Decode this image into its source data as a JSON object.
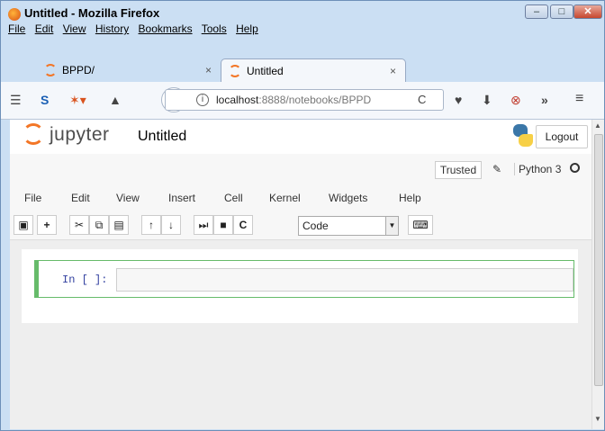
{
  "window": {
    "title": "Untitled - Mozilla Firefox",
    "menu": [
      "File",
      "Edit",
      "View",
      "History",
      "Bookmarks",
      "Tools",
      "Help"
    ],
    "controls": [
      "minimize",
      "maximize",
      "close"
    ]
  },
  "tabs": [
    {
      "label": "BPPD/",
      "close": "×",
      "active": false
    },
    {
      "label": "Untitled",
      "close": "×",
      "active": true
    }
  ],
  "nav": {
    "url_host": "localhost",
    "url_rest": ":8888/notebooks/BPPD",
    "icons": [
      "rss-icon",
      "s-icon",
      "firefox-icon",
      "library-icon",
      "pocket-icon",
      "download-icon",
      "block-icon",
      "overflow-icon",
      "hamburger-menu-icon"
    ]
  },
  "jupyter": {
    "brand": "jupyter",
    "notebook_title": "Untitled",
    "logout": "Logout",
    "trusted": "Trusted",
    "kernel": "Python 3",
    "menu": [
      "File",
      "Edit",
      "View",
      "Insert",
      "Cell",
      "Kernel",
      "Widgets",
      "Help"
    ],
    "cell_type": "Code",
    "cell_prompt": "In [ ]:"
  },
  "colors": {
    "jupyter_orange": "#f37626",
    "cell_border": "#66bb6a",
    "prompt_blue": "#303f9f"
  }
}
